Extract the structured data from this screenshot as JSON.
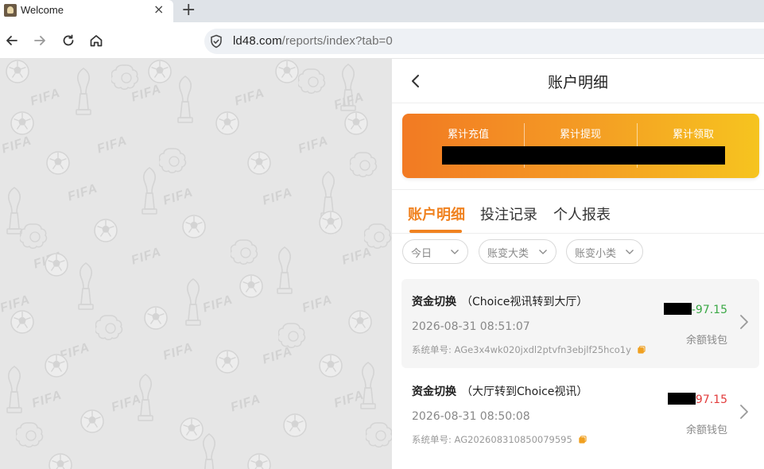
{
  "browser": {
    "tab_title": "Welcome",
    "tab_close": "×",
    "new_tab": "+",
    "url_host": "ld48.com",
    "url_path": "/reports/index?tab=0"
  },
  "wallpaper": {
    "watermark_text": "FIFA"
  },
  "header": {
    "title": "账户明细"
  },
  "summary": {
    "columns": [
      {
        "label": "累计充值"
      },
      {
        "label": "累计提现"
      },
      {
        "label": "累计领取"
      }
    ],
    "values_redacted": true
  },
  "tabs": [
    {
      "label": "账户明细",
      "active": true
    },
    {
      "label": "投注记录",
      "active": false
    },
    {
      "label": "个人报表",
      "active": false
    }
  ],
  "filters": [
    {
      "label": "今日"
    },
    {
      "label": "账变大类"
    },
    {
      "label": "账变小类"
    }
  ],
  "records": [
    {
      "type": "资金切换",
      "detail": "（Choice视讯转到大厅）",
      "time": "2026-08-31 08:51:07",
      "order_label": "系统单号:",
      "order_no": "AGe3x4wk020jxdl2ptvfn3ebjlf25hco1y",
      "amount": "-97.15",
      "amount_color": "#3aa845",
      "wallet": "余额钱包"
    },
    {
      "type": "资金切换",
      "detail": "（大厅转到Choice视讯）",
      "time": "2026-08-31 08:50:08",
      "order_label": "系统单号:",
      "order_no": "AG202608310850079595",
      "amount": "97.15",
      "amount_color": "#e23c3c",
      "wallet": "余额钱包"
    }
  ],
  "colors": {
    "accent": "#f08220",
    "gradient_start": "#f27a23",
    "gradient_end": "#f6c41f"
  }
}
